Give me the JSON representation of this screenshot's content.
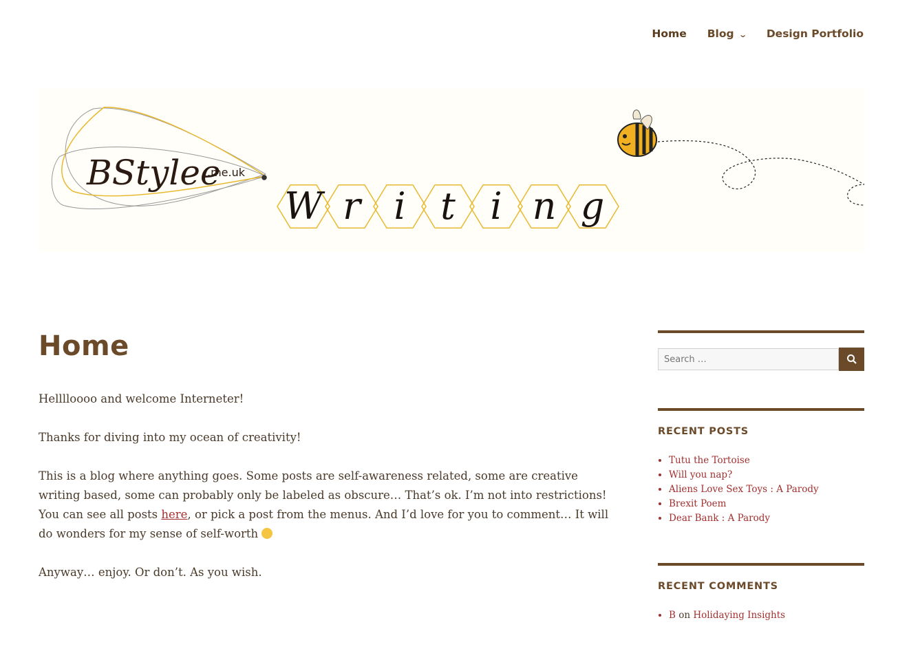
{
  "nav": {
    "items": [
      {
        "label": "Home"
      },
      {
        "label": "Blog"
      },
      {
        "label": "Design Portfolio"
      }
    ]
  },
  "banner": {
    "logo_text": "BStylee",
    "logo_domain": ".me.uk",
    "letters": [
      "W",
      "r",
      "i",
      "t",
      "i",
      "n",
      "g"
    ]
  },
  "page": {
    "title": "Home",
    "paragraphs": {
      "p1": "Helllloooo and welcome Interneter!",
      "p2": "Thanks for diving into my ocean of creativity!",
      "p3_before": "This is a blog where anything goes. Some posts are self-awareness related, some are creative writing based, some can probably only be labeled as obscure… That’s ok. I’m not into restrictions! You can see all posts ",
      "p3_link": "here",
      "p3_after": ", or pick a post from the menus. And I’d love for you to comment… It will do wonders for my sense of self-worth",
      "p4": "Anyway… enjoy. Or don’t. As you wish."
    }
  },
  "sidebar": {
    "search_placeholder": "Search …",
    "recent_posts_title": "RECENT POSTS",
    "recent_posts": [
      "Tutu the Tortoise",
      "Will you nap?",
      "Aliens Love Sex Toys : A Parody",
      "Brexit Poem",
      "Dear Bank : A Parody"
    ],
    "recent_comments_title": "RECENT COMMENTS",
    "recent_comments": [
      {
        "author": "B",
        "on": "on",
        "post": "Holidaying Insights"
      }
    ]
  },
  "colors": {
    "brand_brown": "#6b4a2a",
    "link_red": "#a33030",
    "hex_gold": "#e8b92f"
  }
}
